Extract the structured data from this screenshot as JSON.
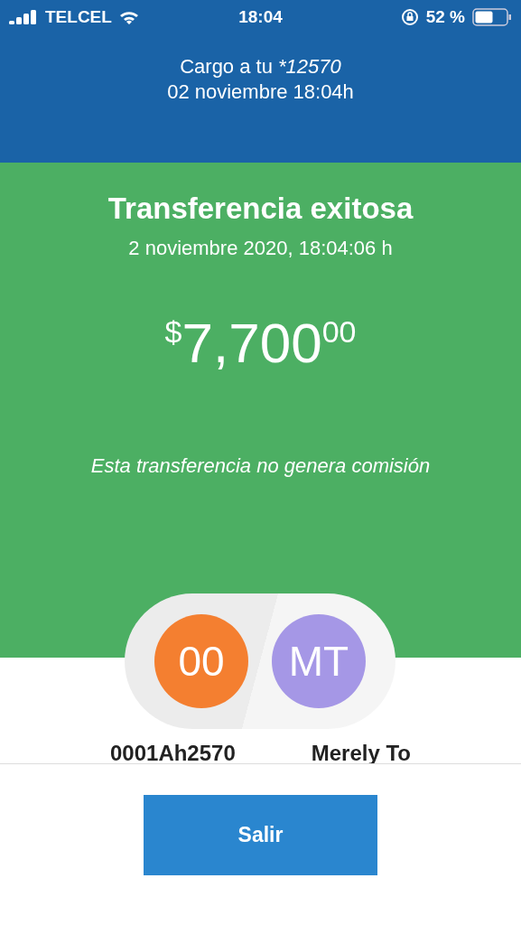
{
  "status_bar": {
    "carrier": "TELCEL",
    "time": "18:04",
    "battery": "52 %"
  },
  "header": {
    "charge_label": "Cargo a tu",
    "account": "*12570",
    "date": "02 noviembre 18:04h"
  },
  "result": {
    "title": "Transferencia exitosa",
    "timestamp": "2 noviembre 2020, 18:04:06 h",
    "currency": "$",
    "amount": "7,700",
    "cents": "00",
    "note": "Esta transferencia no genera comisión"
  },
  "parties": [
    {
      "initials": "00",
      "name": "0001Ah2570",
      "color": "#f47f30"
    },
    {
      "initials": "MT",
      "name": "Merely To",
      "color": "#a597e6"
    }
  ],
  "buttons": [
    {
      "label": "Salir"
    }
  ]
}
